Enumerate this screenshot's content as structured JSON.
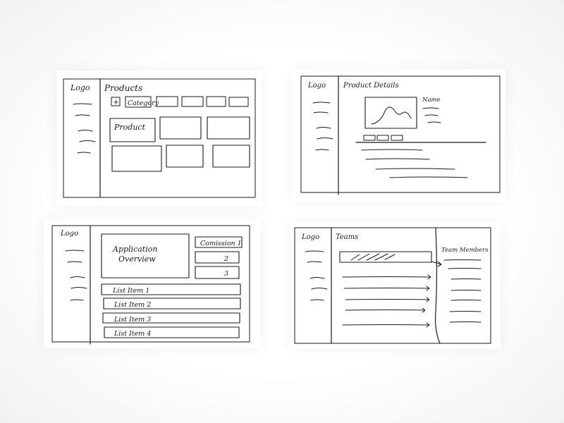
{
  "wireframes": {
    "products": {
      "logo": "Logo",
      "title": "Products",
      "add_symbol": "+",
      "category": "Category",
      "product": "Product"
    },
    "product_details": {
      "logo": "Logo",
      "title": "Product Details",
      "name": "Name"
    },
    "application_overview": {
      "logo": "Logo",
      "overview_title_line1": "Application",
      "overview_title_line2": "Overview",
      "commission_1": "Comission 1",
      "commission_2": "2",
      "commission_3": "3",
      "list_items": [
        "List Item 1",
        "List Item 2",
        "List Item 3",
        "List Item 4"
      ]
    },
    "teams": {
      "logo": "Logo",
      "title": "Teams",
      "team_members": "Team Members"
    }
  }
}
